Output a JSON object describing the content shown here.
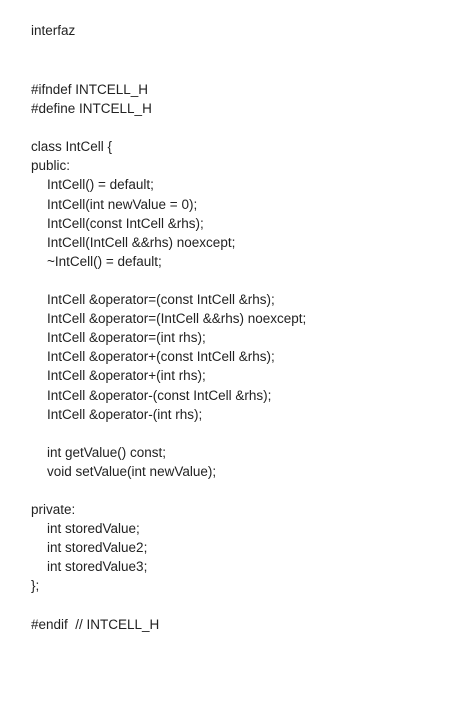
{
  "document": {
    "title": "interfaz",
    "lines": [
      {
        "text": "#ifndef INTCELL_H",
        "indent": 0
      },
      {
        "text": "#define INTCELL_H",
        "indent": 0
      },
      {
        "text": "",
        "indent": 0
      },
      {
        "text": "class IntCell {",
        "indent": 0
      },
      {
        "text": "public:",
        "indent": 0
      },
      {
        "text": "IntCell() = default;",
        "indent": 1
      },
      {
        "text": "IntCell(int newValue = 0);",
        "indent": 1
      },
      {
        "text": "IntCell(const IntCell &rhs);",
        "indent": 1
      },
      {
        "text": "IntCell(IntCell &&rhs) noexcept;",
        "indent": 1
      },
      {
        "text": "~IntCell() = default;",
        "indent": 1
      },
      {
        "text": "",
        "indent": 0
      },
      {
        "text": "IntCell &operator=(const IntCell &rhs);",
        "indent": 1
      },
      {
        "text": "IntCell &operator=(IntCell &&rhs) noexcept;",
        "indent": 1
      },
      {
        "text": "IntCell &operator=(int rhs);",
        "indent": 1
      },
      {
        "text": "IntCell &operator+(const IntCell &rhs);",
        "indent": 1
      },
      {
        "text": "IntCell &operator+(int rhs);",
        "indent": 1
      },
      {
        "text": "IntCell &operator-(const IntCell &rhs);",
        "indent": 1
      },
      {
        "text": "IntCell &operator-(int rhs);",
        "indent": 1
      },
      {
        "text": "",
        "indent": 0
      },
      {
        "text": "int getValue() const;",
        "indent": 1
      },
      {
        "text": "void setValue(int newValue);",
        "indent": 1
      },
      {
        "text": "",
        "indent": 0
      },
      {
        "text": "private:",
        "indent": 0
      },
      {
        "text": "int storedValue;",
        "indent": 1
      },
      {
        "text": "int storedValue2;",
        "indent": 1
      },
      {
        "text": "int storedValue3;",
        "indent": 1
      },
      {
        "text": "};",
        "indent": 0
      },
      {
        "text": "",
        "indent": 0
      },
      {
        "text": "#endif  // INTCELL_H",
        "indent": 0
      }
    ]
  }
}
